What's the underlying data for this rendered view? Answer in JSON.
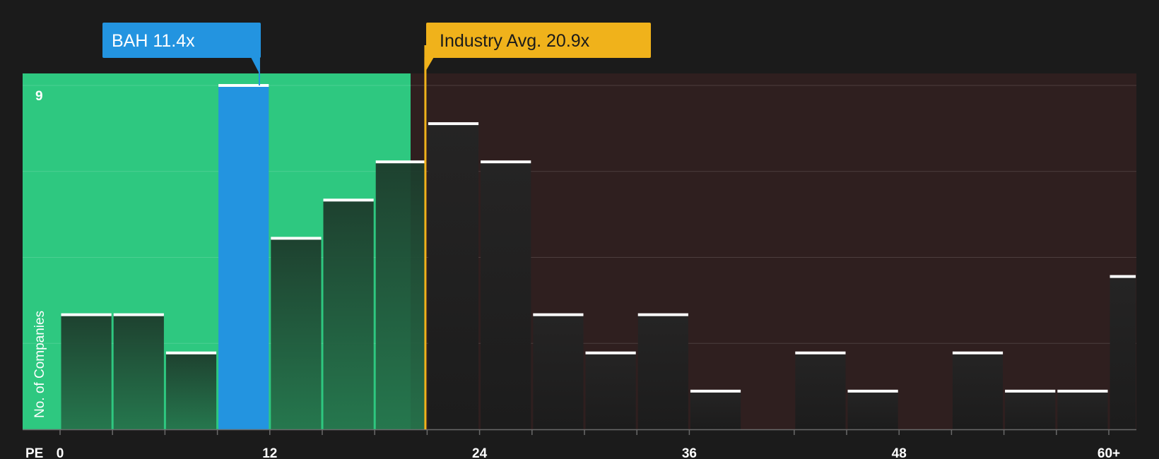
{
  "chart_data": {
    "type": "bar",
    "title": "",
    "xlabel": "PE",
    "ylabel": "No. of Companies",
    "xlim": [
      0,
      60
    ],
    "ylim": [
      0,
      9
    ],
    "x_ticks": [
      "0",
      "12",
      "24",
      "36",
      "48",
      "60+"
    ],
    "x_tick_values": [
      0,
      12,
      24,
      36,
      48,
      60
    ],
    "y_ticks": [
      {
        "value": 9,
        "label": "9"
      }
    ],
    "gridlines_y": [
      2.25,
      4.5,
      6.75,
      9
    ],
    "bins": [
      {
        "x0": 0,
        "x1": 3,
        "count": 3
      },
      {
        "x0": 3,
        "x1": 6,
        "count": 3
      },
      {
        "x0": 6,
        "x1": 9,
        "count": 2
      },
      {
        "x0": 9,
        "x1": 12,
        "count": 9,
        "highlight": true
      },
      {
        "x0": 12,
        "x1": 15,
        "count": 5
      },
      {
        "x0": 15,
        "x1": 18,
        "count": 6
      },
      {
        "x0": 18,
        "x1": 21,
        "count": 7
      },
      {
        "x0": 21,
        "x1": 24,
        "count": 8
      },
      {
        "x0": 24,
        "x1": 27,
        "count": 7
      },
      {
        "x0": 27,
        "x1": 30,
        "count": 3
      },
      {
        "x0": 30,
        "x1": 33,
        "count": 2
      },
      {
        "x0": 33,
        "x1": 36,
        "count": 3
      },
      {
        "x0": 36,
        "x1": 39,
        "count": 1
      },
      {
        "x0": 42,
        "x1": 45,
        "count": 2
      },
      {
        "x0": 45,
        "x1": 48,
        "count": 1
      },
      {
        "x0": 51,
        "x1": 54,
        "count": 2
      },
      {
        "x0": 54,
        "x1": 57,
        "count": 1
      },
      {
        "x0": 57,
        "x1": 60,
        "count": 1
      },
      {
        "x0": 60,
        "x1": 61.6,
        "count": 4
      }
    ],
    "company": {
      "label": "BAH 11.4x",
      "value": 11.4
    },
    "industry_avg": {
      "label": "Industry Avg. 20.9x",
      "value": 20.9
    },
    "fair_zone_end": 20.9,
    "colors": {
      "background": "#1b1b1b",
      "good_zone": "#2ec880",
      "bad_zone": "#2f1f1f",
      "company_bar": "#2394e0",
      "industry_line": "#f0b21b",
      "bar_cap": "#ffffff"
    }
  }
}
